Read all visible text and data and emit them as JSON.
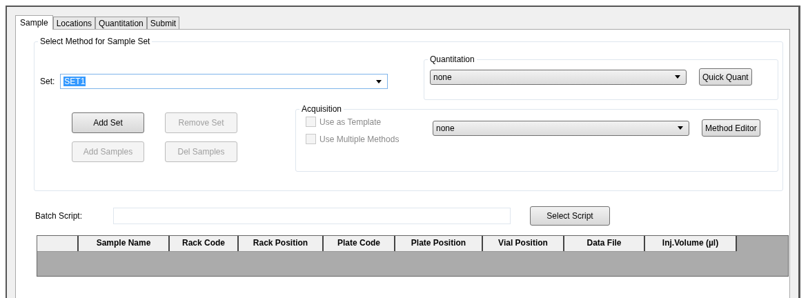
{
  "tabs": [
    {
      "label": "Sample",
      "selected": true
    },
    {
      "label": "Locations",
      "selected": false
    },
    {
      "label": "Quantitation",
      "selected": false
    },
    {
      "label": "Submit",
      "selected": false
    }
  ],
  "method_group": {
    "title": "Select Method for Sample Set",
    "set": {
      "label": "Set:",
      "value": "SET1"
    },
    "buttons": [
      {
        "label": "Add Set",
        "disabled": false
      },
      {
        "label": "Remove Set",
        "disabled": true
      },
      {
        "label": "Add Samples",
        "disabled": true
      },
      {
        "label": "Del Samples",
        "disabled": true
      }
    ],
    "quantitation": {
      "title": "Quantitation",
      "value": "none",
      "button": "Quick Quant"
    },
    "acquisition": {
      "title": "Acquisition",
      "checkboxes": [
        {
          "label": "Use as Template",
          "checked": false,
          "disabled": true
        },
        {
          "label": "Use Multiple Methods",
          "checked": false,
          "disabled": true
        }
      ],
      "value": "none",
      "button": "Method Editor"
    }
  },
  "batch_script": {
    "label": "Batch Script:",
    "button": "Select Script"
  },
  "table": {
    "columns": [
      "",
      "Sample Name",
      "Rack Code",
      "Rack Position",
      "Plate Code",
      "Plate Position",
      "Vial Position",
      "Data File",
      "Inj.Volume (µl)"
    ]
  }
}
